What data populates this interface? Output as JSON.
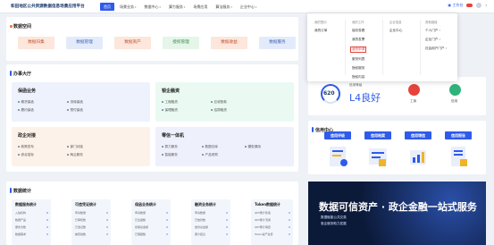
{
  "header": {
    "title": "和田地区公共资源数据信息场景应用平台",
    "nav": [
      {
        "label": "首页",
        "active": true
      },
      {
        "label": "场景业务",
        "caret": true
      },
      {
        "label": "数据中心",
        "caret": true
      },
      {
        "label": "算力服务",
        "caret": true
      },
      {
        "label": "场景应用",
        "caret": false
      },
      {
        "label": "算法服务",
        "caret": true
      },
      {
        "label": "企业中心",
        "caret": true
      }
    ],
    "workbench": "工作台",
    "badge": "99+"
  },
  "data_space": {
    "title": "数据空间",
    "tiles": [
      "数据归集",
      "数据管理",
      "数据资产",
      "授权管理",
      "数据收益",
      "数据服务"
    ]
  },
  "service_hall": {
    "title": "办事大厅",
    "blocks": [
      {
        "title": "保函业务",
        "items": [
          "期货保函",
          "流转保函",
          "履约保函",
          "预付保函"
        ]
      },
      {
        "title": "银企融资",
        "items": [
          "工程融资",
          "应收账款",
          "保理融资",
          "结算融资"
        ]
      },
      {
        "title": "政企对接",
        "items": [
          "政策发布",
          "部门对接",
          "综合招标",
          "两企服务"
        ]
      },
      {
        "title": "零信一体机",
        "items": [
          "算力服务",
          "数据仓库",
          "模型调用",
          "智能服务",
          "产品采购"
        ]
      }
    ]
  },
  "dropdown": {
    "columns": [
      {
        "head": "我的签约",
        "items": [
          "我的订单"
        ]
      },
      {
        "head": "我的工作",
        "items": [
          "保存查看",
          "我的发票",
          "我的申请",
          "服务列表",
          "授权服务",
          "授权内容"
        ],
        "highlight": 2
      },
      {
        "head": "企业信息",
        "items": [
          "企业中心"
        ]
      },
      {
        "head": "其他链接",
        "items": [
          "个人门户",
          "企业门户",
          "社会用户门户"
        ]
      }
    ]
  },
  "credit_score": {
    "value": "620",
    "level_label": "信用等级",
    "level": "L4良好",
    "tag1": "工商",
    "tag2": "信用"
  },
  "credit_center": {
    "title": "信用中心",
    "buttons": [
      "信用评级",
      "信用档案",
      "信用增信",
      "信用报告"
    ]
  },
  "data_stats": {
    "title": "数据统计",
    "cards": [
      {
        "title": "数据服务统计",
        "rows": [
          [
            "入驻机构",
            "6"
          ],
          [
            "数据产品",
            "0"
          ],
          [
            "服务次数",
            "0"
          ],
          [
            "数据需求",
            "0"
          ]
        ]
      },
      {
        "title": "可信凭证统计",
        "rows": [
          [
            "申请数量",
            "0"
          ],
          [
            "已审核数",
            "0"
          ],
          [
            "已发证数",
            "0"
          ],
          [
            "被查验数",
            "0"
          ]
        ]
      },
      {
        "title": "保函业务统计",
        "rows": [
          [
            "申请数量",
            "0"
          ],
          [
            "已出函数",
            "0"
          ],
          [
            "担保总金额",
            "0"
          ],
          [
            "已理赔数",
            "0"
          ]
        ]
      },
      {
        "title": "融资业务统计",
        "rows": [
          [
            "申请数量",
            "0"
          ],
          [
            "已放款数",
            "0"
          ],
          [
            "放款总金额",
            "0"
          ],
          [
            "累计结息",
            "0"
          ]
        ]
      },
      {
        "title": "Token数据统计",
        "rows": [
          [
            "QKT累计铸造",
            "0"
          ],
          [
            "QKT累计流通",
            "0"
          ],
          [
            "QKT累计销毁",
            "0"
          ],
          [
            "Token资产总值",
            "0"
          ]
        ]
      }
    ]
  },
  "banner": {
    "title": "数据可信资产 · 政企金融一站式服务",
    "lines": [
      "数据赋能公共交易",
      "惠企服务助力发展"
    ]
  },
  "colors": {
    "primary": "#2f5bea",
    "accent_red": "#e6433a",
    "orange": "#f07b3a",
    "green": "#2fb37a"
  }
}
